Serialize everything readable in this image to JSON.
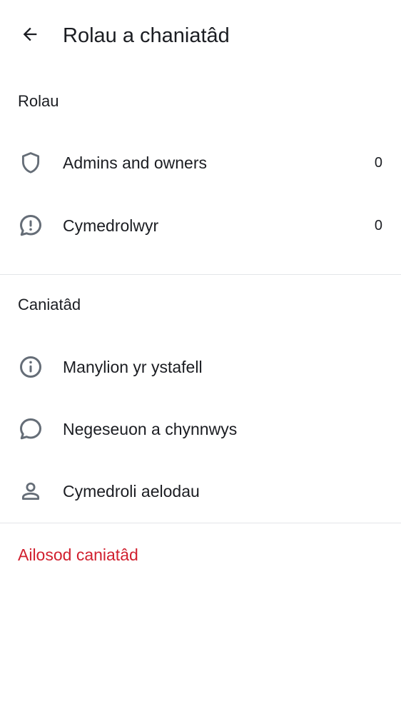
{
  "header": {
    "back_icon": "arrow-left-icon",
    "title": "Rolau a chaniatâd"
  },
  "roles_section": {
    "title": "Rolau",
    "items": [
      {
        "icon": "shield-icon",
        "label": "Admins and owners",
        "count": "0"
      },
      {
        "icon": "chat-alert-icon",
        "label": "Cymedrolwyr",
        "count": "0"
      }
    ]
  },
  "permissions_section": {
    "title": "Caniatâd",
    "items": [
      {
        "icon": "info-icon",
        "label": "Manylion yr ystafell"
      },
      {
        "icon": "chat-bubble-icon",
        "label": "Negeseuon a chynnwys"
      },
      {
        "icon": "person-icon",
        "label": "Cymedroli aelodau"
      }
    ]
  },
  "reset": {
    "label": "Ailosod caniatâd"
  },
  "colors": {
    "text": "#1b1d22",
    "icon": "#656d77",
    "danger": "#d1202f",
    "divider": "#e3e5e8",
    "background": "#ffffff"
  }
}
